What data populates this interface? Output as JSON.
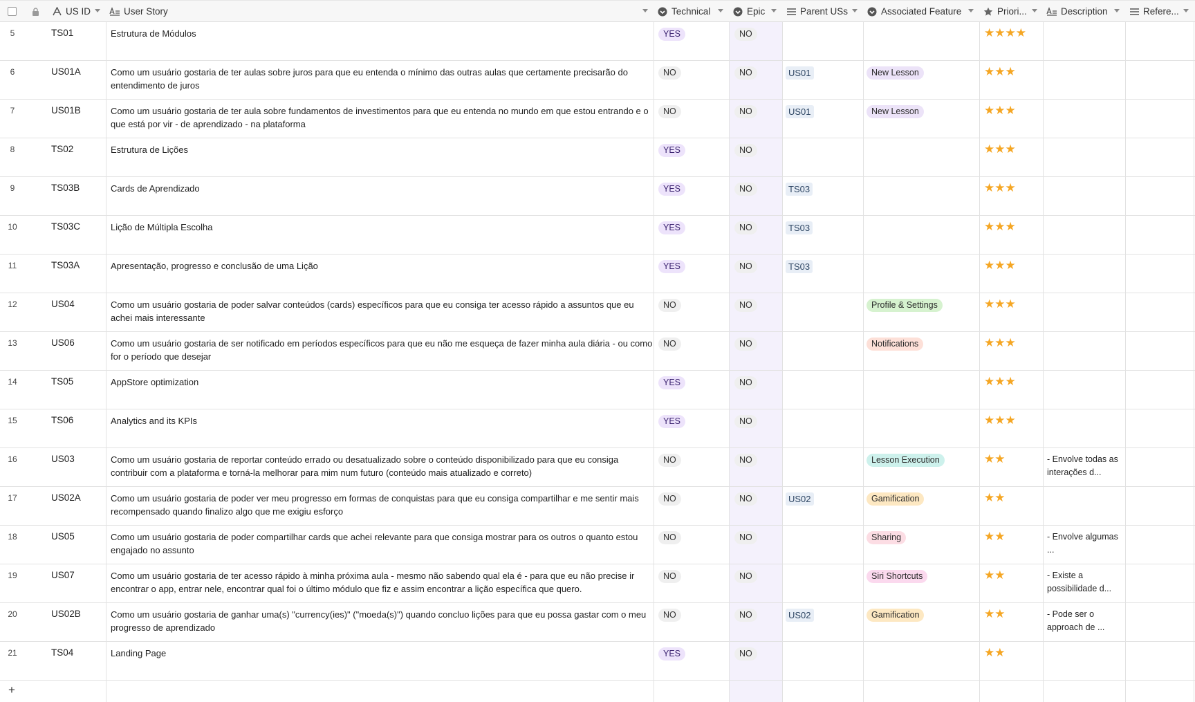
{
  "header": {
    "us_id": "US ID",
    "user_story": "User Story",
    "technical": "Technical",
    "epic": "Epic",
    "parent_uss": "Parent USs",
    "associated_feature": "Associated Feature",
    "priority": "Priori...",
    "description": "Description",
    "references": "Refere..."
  },
  "colors": {
    "yes_bg": "#ede3fb",
    "no_bg": "#efefef",
    "star": "#f5a623",
    "new_lesson": "#ece3f8",
    "profile_settings": "#d6f2cf",
    "notifications": "#fde0d8",
    "lesson_execution": "#cdf1ec",
    "gamification": "#fde8c2",
    "sharing": "#fcdde4",
    "siri_shortcuts": "#fbd9ee"
  },
  "add_row_label": "+",
  "rows": [
    {
      "num": "5",
      "id": "TS01",
      "story": "Estrutura de Módulos",
      "tech": "YES",
      "epic": "NO",
      "parent": "",
      "feature": "",
      "feature_color": "",
      "stars": "★★★★",
      "desc": ""
    },
    {
      "num": "6",
      "id": "US01A",
      "story": "Como um usuário gostaria de ter aulas sobre juros para que eu entenda o mínimo das outras aulas que certamente precisarão do entendimento de juros",
      "tech": "NO",
      "epic": "NO",
      "parent": "US01",
      "feature": "New Lesson",
      "feature_color": "#ece3f8",
      "stars": "★★★",
      "desc": ""
    },
    {
      "num": "7",
      "id": "US01B",
      "story": "Como um usuário gostaria de ter aula sobre fundamentos de investimentos para que eu entenda no mundo em que estou entrando e o que está por vir - de aprendizado - na plataforma",
      "tech": "NO",
      "epic": "NO",
      "parent": "US01",
      "feature": "New Lesson",
      "feature_color": "#ece3f8",
      "stars": "★★★",
      "desc": ""
    },
    {
      "num": "8",
      "id": "TS02",
      "story": "Estrutura de Lições",
      "tech": "YES",
      "epic": "NO",
      "parent": "",
      "feature": "",
      "feature_color": "",
      "stars": "★★★",
      "desc": ""
    },
    {
      "num": "9",
      "id": "TS03B",
      "story": "Cards de Aprendizado",
      "tech": "YES",
      "epic": "NO",
      "parent": "TS03",
      "feature": "",
      "feature_color": "",
      "stars": "★★★",
      "desc": ""
    },
    {
      "num": "10",
      "id": "TS03C",
      "story": "Lição de Múltipla Escolha",
      "tech": "YES",
      "epic": "NO",
      "parent": "TS03",
      "feature": "",
      "feature_color": "",
      "stars": "★★★",
      "desc": ""
    },
    {
      "num": "11",
      "id": "TS03A",
      "story": "Apresentação, progresso e conclusão de uma Lição",
      "tech": "YES",
      "epic": "NO",
      "parent": "TS03",
      "feature": "",
      "feature_color": "",
      "stars": "★★★",
      "desc": ""
    },
    {
      "num": "12",
      "id": "US04",
      "story": "Como um usuário gostaria de poder salvar conteúdos (cards) específicos para que eu consiga ter acesso rápido a assuntos que eu achei mais interessante",
      "tech": "NO",
      "epic": "NO",
      "parent": "",
      "feature": "Profile & Settings",
      "feature_color": "#d6f2cf",
      "stars": "★★★",
      "desc": ""
    },
    {
      "num": "13",
      "id": "US06",
      "story": "Como um usuário gostaria de ser notificado em períodos específicos para que eu não me esqueça de fazer minha aula diária - ou como for o período que desejar",
      "tech": "NO",
      "epic": "NO",
      "parent": "",
      "feature": "Notifications",
      "feature_color": "#fde0d8",
      "stars": "★★★",
      "desc": ""
    },
    {
      "num": "14",
      "id": "TS05",
      "story": "AppStore optimization",
      "tech": "YES",
      "epic": "NO",
      "parent": "",
      "feature": "",
      "feature_color": "",
      "stars": "★★★",
      "desc": ""
    },
    {
      "num": "15",
      "id": "TS06",
      "story": "Analytics and its KPIs",
      "tech": "YES",
      "epic": "NO",
      "parent": "",
      "feature": "",
      "feature_color": "",
      "stars": "★★★",
      "desc": ""
    },
    {
      "num": "16",
      "id": "US03",
      "story": "Como um usuário gostaria de reportar conteúdo errado ou desatualizado sobre o conteúdo disponibilizado para que eu consiga contribuir com a plataforma e torná-la melhorar para mim num futuro (conteúdo mais atualizado e correto)",
      "tech": "NO",
      "epic": "NO",
      "parent": "",
      "feature": "Lesson Execution",
      "feature_color": "#cdf1ec",
      "stars": "★★",
      "desc": "- Envolve todas as interações d..."
    },
    {
      "num": "17",
      "id": "US02A",
      "story": "Como um usuário gostaria de poder ver meu progresso em formas de conquistas para que eu consiga compartilhar e me sentir mais recompensado quando finalizo algo que me exigiu esforço",
      "tech": "NO",
      "epic": "NO",
      "parent": "US02",
      "feature": "Gamification",
      "feature_color": "#fde8c2",
      "stars": "★★",
      "desc": ""
    },
    {
      "num": "18",
      "id": "US05",
      "story": "Como um usuário gostaria de poder compartilhar cards que achei relevante para que consiga mostrar para os outros o quanto estou engajado no assunto",
      "tech": "NO",
      "epic": "NO",
      "parent": "",
      "feature": "Sharing",
      "feature_color": "#fcdde4",
      "stars": "★★",
      "desc": "- Envolve algumas ..."
    },
    {
      "num": "19",
      "id": "US07",
      "story": "Como um usuário gostaria de ter acesso rápido à minha próxima aula - mesmo não sabendo qual ela é - para que eu não precise ir encontrar o app, entrar nele, encontrar qual foi o último módulo que fiz e assim encontrar a lição específica que quero.",
      "tech": "NO",
      "epic": "NO",
      "parent": "",
      "feature": "Siri Shortcuts",
      "feature_color": "#fbd9ee",
      "stars": "★★",
      "desc": "- Existe a possibilidade d..."
    },
    {
      "num": "20",
      "id": "US02B",
      "story": "Como um usuário gostaria de ganhar uma(s) \"currency(ies)\" (\"moeda(s)\")  quando concluo lições para que eu possa gastar com o meu progresso de aprendizado",
      "tech": "NO",
      "epic": "NO",
      "parent": "US02",
      "feature": "Gamification",
      "feature_color": "#fde8c2",
      "stars": "★★",
      "desc": "- Pode ser o approach de ..."
    },
    {
      "num": "21",
      "id": "TS04",
      "story": "Landing Page",
      "tech": "YES",
      "epic": "NO",
      "parent": "",
      "feature": "",
      "feature_color": "",
      "stars": "★★",
      "desc": ""
    }
  ]
}
